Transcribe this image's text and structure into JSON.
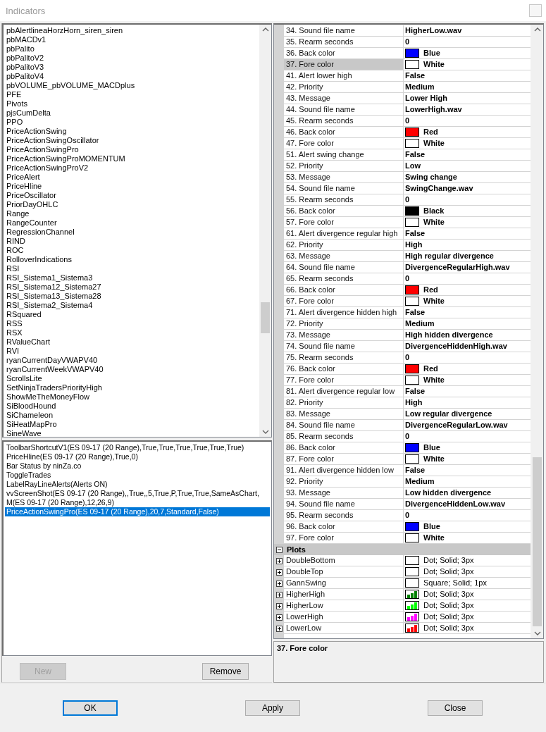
{
  "window": {
    "title": "Indicators"
  },
  "indicator_list": {
    "items": [
      {
        "label": "pbAlertlineaHorzHorn_siren_siren",
        "selected": false
      },
      {
        "label": "pbMACDv1",
        "selected": false
      },
      {
        "label": "pbPalito",
        "selected": false
      },
      {
        "label": "pbPalitoV2",
        "selected": false
      },
      {
        "label": "pbPalitoV3",
        "selected": false
      },
      {
        "label": "pbPalitoV4",
        "selected": false
      },
      {
        "label": "pbVOLUME_pbVOLUME_MACDplus",
        "selected": false
      },
      {
        "label": "PFE",
        "selected": false
      },
      {
        "label": "Pivots",
        "selected": false
      },
      {
        "label": "pjsCumDelta",
        "selected": false
      },
      {
        "label": "PPO",
        "selected": false
      },
      {
        "label": "PriceActionSwing",
        "selected": false
      },
      {
        "label": "PriceActionSwingOscillator",
        "selected": false
      },
      {
        "label": "PriceActionSwingPro",
        "selected": false
      },
      {
        "label": "PriceActionSwingProMOMENTUM",
        "selected": false
      },
      {
        "label": "PriceActionSwingProV2",
        "selected": false
      },
      {
        "label": "PriceAlert",
        "selected": false
      },
      {
        "label": "PriceHline",
        "selected": false
      },
      {
        "label": "PriceOscillator",
        "selected": false
      },
      {
        "label": "PriorDayOHLC",
        "selected": false
      },
      {
        "label": "Range",
        "selected": false
      },
      {
        "label": "RangeCounter",
        "selected": false
      },
      {
        "label": "RegressionChannel",
        "selected": false
      },
      {
        "label": "RIND",
        "selected": false
      },
      {
        "label": "ROC",
        "selected": false
      },
      {
        "label": "RolloverIndications",
        "selected": false
      },
      {
        "label": "RSI",
        "selected": false
      },
      {
        "label": "RSI_Sistema1_Sistema3",
        "selected": false
      },
      {
        "label": "RSI_Sistema12_Sistema27",
        "selected": false
      },
      {
        "label": "RSI_Sistema13_Sistema28",
        "selected": false
      },
      {
        "label": "RSI_Sistema2_Sistema4",
        "selected": false
      },
      {
        "label": "RSquared",
        "selected": false
      },
      {
        "label": "RSS",
        "selected": false
      },
      {
        "label": "RSX",
        "selected": false
      },
      {
        "label": "RValueChart",
        "selected": false
      },
      {
        "label": "RVI",
        "selected": false
      },
      {
        "label": "ryanCurrentDayVWAPV40",
        "selected": false
      },
      {
        "label": "ryanCurrentWeekVWAPV40",
        "selected": false
      },
      {
        "label": "ScrollsLite",
        "selected": false
      },
      {
        "label": "SetNinjaTradersPriorityHigh",
        "selected": false
      },
      {
        "label": "ShowMeTheMoneyFlow",
        "selected": false
      },
      {
        "label": "SiBloodHound",
        "selected": false
      },
      {
        "label": "SiChameleon",
        "selected": false
      },
      {
        "label": "SiHeatMapPro",
        "selected": false
      },
      {
        "label": "SineWave",
        "selected": false
      }
    ]
  },
  "applied_list": {
    "items": [
      {
        "label": "ToolbarShortcutV1(ES 09-17 (20 Range),True,True,True,True,True,True)",
        "selected": false
      },
      {
        "label": "PriceHline(ES 09-17 (20 Range),True,0)",
        "selected": false
      },
      {
        "label": "Bar Status by ninZa.co",
        "selected": false
      },
      {
        "label": "ToggleTrades",
        "selected": false
      },
      {
        "label": "LabelRayLineAlerts(Alerts ON)",
        "selected": false
      },
      {
        "label": "vvScreenShot(ES 09-17 (20 Range),,True,,5,True,P,True,True,SameAsChart,",
        "selected": false
      },
      {
        "label": "M(ES 09-17 (20 Range),12,26,9)",
        "selected": false
      },
      {
        "label": "PriceActionSwingPro(ES 09-17 (20 Range),20,7,Standard,False)",
        "selected": true
      }
    ]
  },
  "list_buttons": [
    {
      "label": "New",
      "disabled": true
    },
    {
      "label": "Remove",
      "disabled": false
    }
  ],
  "properties": [
    {
      "name": "34. Sound file name",
      "value": "HigherLow.wav",
      "kind": "text",
      "selected": false
    },
    {
      "name": "35. Rearm seconds",
      "value": "0",
      "kind": "text",
      "selected": false
    },
    {
      "name": "36. Back color",
      "value": "Blue",
      "kind": "color",
      "color": "#0000ff",
      "selected": false
    },
    {
      "name": "37. Fore color",
      "value": "White",
      "kind": "color",
      "color": "#ffffff",
      "selected": true
    },
    {
      "name": "41. Alert lower high",
      "value": "False",
      "kind": "text",
      "selected": false
    },
    {
      "name": "42. Priority",
      "value": "Medium",
      "kind": "text",
      "selected": false
    },
    {
      "name": "43. Message",
      "value": "Lower High",
      "kind": "text",
      "selected": false
    },
    {
      "name": "44. Sound file name",
      "value": "LowerHigh.wav",
      "kind": "text",
      "selected": false
    },
    {
      "name": "45. Rearm seconds",
      "value": "0",
      "kind": "text",
      "selected": false
    },
    {
      "name": "46. Back color",
      "value": "Red",
      "kind": "color",
      "color": "#ff0000",
      "selected": false
    },
    {
      "name": "47. Fore color",
      "value": "White",
      "kind": "color",
      "color": "#ffffff",
      "selected": false
    },
    {
      "name": "51. Alert swing change",
      "value": "False",
      "kind": "text",
      "selected": false
    },
    {
      "name": "52. Priority",
      "value": "Low",
      "kind": "text",
      "selected": false
    },
    {
      "name": "53. Message",
      "value": "Swing change",
      "kind": "text",
      "selected": false
    },
    {
      "name": "54. Sound file name",
      "value": "SwingChange.wav",
      "kind": "text",
      "selected": false
    },
    {
      "name": "55. Rearm seconds",
      "value": "0",
      "kind": "text",
      "selected": false
    },
    {
      "name": "56. Back color",
      "value": "Black",
      "kind": "color",
      "color": "#000000",
      "selected": false
    },
    {
      "name": "57. Fore color",
      "value": "White",
      "kind": "color",
      "color": "#ffffff",
      "selected": false
    },
    {
      "name": "61. Alert divergence regular high",
      "value": "False",
      "kind": "text",
      "selected": false
    },
    {
      "name": "62. Priority",
      "value": "High",
      "kind": "text",
      "selected": false
    },
    {
      "name": "63. Message",
      "value": "High regular divergence",
      "kind": "text",
      "selected": false
    },
    {
      "name": "64. Sound file name",
      "value": "DivergenceRegularHigh.wav",
      "kind": "text",
      "selected": false
    },
    {
      "name": "65. Rearm seconds",
      "value": "0",
      "kind": "text",
      "selected": false
    },
    {
      "name": "66. Back color",
      "value": "Red",
      "kind": "color",
      "color": "#ff0000",
      "selected": false
    },
    {
      "name": "67. Fore color",
      "value": "White",
      "kind": "color",
      "color": "#ffffff",
      "selected": false
    },
    {
      "name": "71. Alert divergence hidden high",
      "value": "False",
      "kind": "text",
      "selected": false
    },
    {
      "name": "72. Priority",
      "value": "Medium",
      "kind": "text",
      "selected": false
    },
    {
      "name": "73. Message",
      "value": "High hidden divergence",
      "kind": "text",
      "selected": false
    },
    {
      "name": "74. Sound file name",
      "value": "DivergenceHiddenHigh.wav",
      "kind": "text",
      "selected": false
    },
    {
      "name": "75. Rearm seconds",
      "value": "0",
      "kind": "text",
      "selected": false
    },
    {
      "name": "76. Back color",
      "value": "Red",
      "kind": "color",
      "color": "#ff0000",
      "selected": false
    },
    {
      "name": "77. Fore color",
      "value": "White",
      "kind": "color",
      "color": "#ffffff",
      "selected": false
    },
    {
      "name": "81. Alert divergence regular low",
      "value": "False",
      "kind": "text",
      "selected": false
    },
    {
      "name": "82. Priority",
      "value": "High",
      "kind": "text",
      "selected": false
    },
    {
      "name": "83. Message",
      "value": "Low regular divergence",
      "kind": "text",
      "selected": false
    },
    {
      "name": "84. Sound file name",
      "value": "DivergenceRegularLow.wav",
      "kind": "text",
      "selected": false
    },
    {
      "name": "85. Rearm seconds",
      "value": "0",
      "kind": "text",
      "selected": false
    },
    {
      "name": "86. Back color",
      "value": "Blue",
      "kind": "color",
      "color": "#0000ff",
      "selected": false
    },
    {
      "name": "87. Fore color",
      "value": "White",
      "kind": "color",
      "color": "#ffffff",
      "selected": false
    },
    {
      "name": "91. Alert divergence hidden low",
      "value": "False",
      "kind": "text",
      "selected": false
    },
    {
      "name": "92. Priority",
      "value": "Medium",
      "kind": "text",
      "selected": false
    },
    {
      "name": "93. Message",
      "value": "Low hidden divergence",
      "kind": "text",
      "selected": false
    },
    {
      "name": "94. Sound file name",
      "value": "DivergenceHiddenLow.wav",
      "kind": "text",
      "selected": false
    },
    {
      "name": "95. Rearm seconds",
      "value": "0",
      "kind": "text",
      "selected": false
    },
    {
      "name": "96. Back color",
      "value": "Blue",
      "kind": "color",
      "color": "#0000ff",
      "selected": false
    },
    {
      "name": "97. Fore color",
      "value": "White",
      "kind": "color",
      "color": "#ffffff",
      "selected": false
    }
  ],
  "plots": {
    "label": "Plots",
    "expanded": true,
    "items": [
      {
        "name": "DoubleBottom",
        "value": "Dot; Solid; 3px",
        "expanded": false
      },
      {
        "name": "DoubleTop",
        "value": "Dot; Solid; 3px",
        "expanded": false
      },
      {
        "name": "GannSwing",
        "value": "Square; Solid; 1px",
        "expanded": false
      },
      {
        "name": "HigherHigh",
        "value": "Dot; Solid; 3px",
        "color": "#008000",
        "expanded": false
      },
      {
        "name": "HigherLow",
        "value": "Dot; Solid; 3px",
        "color": "#00ff00",
        "expanded": false
      },
      {
        "name": "LowerHigh",
        "value": "Dot; Solid; 3px",
        "color": "#ff00ff",
        "expanded": false
      },
      {
        "name": "LowerLow",
        "value": "Dot; Solid; 3px",
        "color": "#ff0000",
        "expanded": false
      }
    ]
  },
  "description": {
    "title": "37. Fore color"
  },
  "dialog_buttons": [
    {
      "label": "OK",
      "default": true
    },
    {
      "label": "Apply",
      "default": false
    },
    {
      "label": "Close",
      "default": false
    }
  ]
}
